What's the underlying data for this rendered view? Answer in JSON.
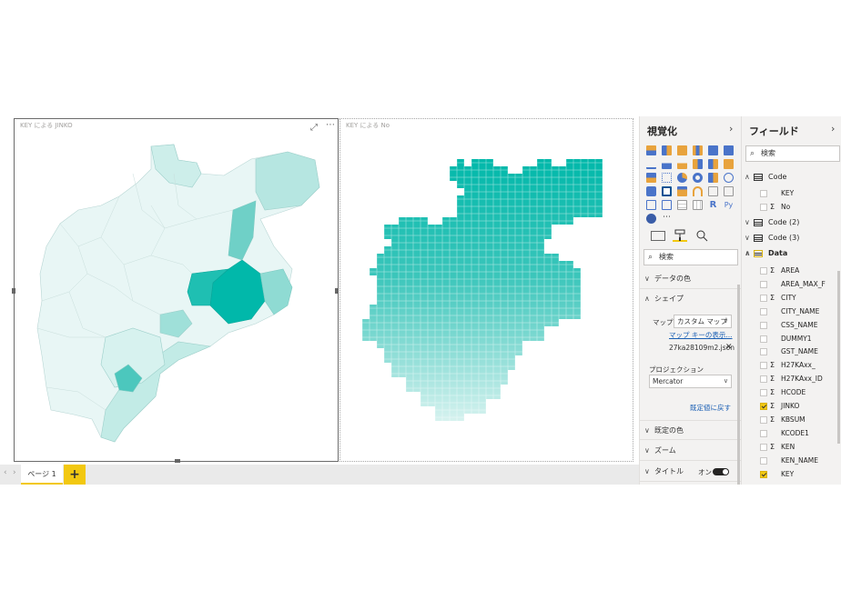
{
  "report": {
    "visuals": [
      {
        "title": "KEY による JINKO"
      },
      {
        "title": "KEY による No"
      }
    ],
    "more_icon": "⋯",
    "focus_icon": "⤢"
  },
  "page_tabs": {
    "prev": "‹",
    "next": "›",
    "page1_label": "ページ 1",
    "add_label": "+"
  },
  "viz_pane": {
    "title": "視覚化",
    "search_placeholder": "検索",
    "sections": {
      "data_colors": "データの色",
      "shape": "シェイプ",
      "default_color": "既定の色",
      "zoom": "ズーム",
      "title": "タイトル"
    },
    "shape": {
      "map_label": "マップ",
      "map_value": "カスタム マップ",
      "map_keys_link": "マップ キーの表示...",
      "file_name": "27ka28109m2.json",
      "projection_label": "プロジェクション",
      "projection_value": "Mercator",
      "reset_link": "既定値に戻す"
    },
    "title_toggle": "オン",
    "chevrons": {
      "collapse": "›",
      "right": "∨",
      "open": "∧"
    },
    "tab_icons": [
      "fields-icon",
      "format-roller-icon",
      "analytics-icon"
    ],
    "colors": {
      "accent": "#f2c811",
      "teal": "#01b8aa"
    }
  },
  "fields_pane": {
    "title": "フィールド",
    "search_placeholder": "検索",
    "tables": [
      {
        "name": "Code",
        "expanded": true
      },
      {
        "name": "Code (2)",
        "expanded": false
      },
      {
        "name": "Code (3)",
        "expanded": false
      },
      {
        "name": "Data",
        "expanded": true
      }
    ],
    "code_fields": [
      {
        "name": "KEY",
        "sigma": "",
        "checked": false
      },
      {
        "name": "No",
        "sigma": "Σ",
        "checked": false
      }
    ],
    "data_fields": [
      {
        "name": "AREA",
        "sigma": "Σ",
        "checked": false
      },
      {
        "name": "AREA_MAX_F",
        "sigma": "",
        "checked": false
      },
      {
        "name": "CITY",
        "sigma": "Σ",
        "checked": false
      },
      {
        "name": "CITY_NAME",
        "sigma": "",
        "checked": false
      },
      {
        "name": "CSS_NAME",
        "sigma": "",
        "checked": false
      },
      {
        "name": "DUMMY1",
        "sigma": "",
        "checked": false
      },
      {
        "name": "GST_NAME",
        "sigma": "",
        "checked": false
      },
      {
        "name": "H27KAxx_",
        "sigma": "Σ",
        "checked": false
      },
      {
        "name": "H27KAxx_ID",
        "sigma": "Σ",
        "checked": false
      },
      {
        "name": "HCODE",
        "sigma": "Σ",
        "checked": false
      },
      {
        "name": "JINKO",
        "sigma": "Σ",
        "checked": true
      },
      {
        "name": "KBSUM",
        "sigma": "Σ",
        "checked": false
      },
      {
        "name": "KCODE1",
        "sigma": "",
        "checked": false
      },
      {
        "name": "KEN",
        "sigma": "Σ",
        "checked": false
      },
      {
        "name": "KEN_NAME",
        "sigma": "",
        "checked": false
      },
      {
        "name": "KEY",
        "sigma": "",
        "checked": true
      }
    ],
    "chevron_expanded": "∧",
    "chevron_collapsed": "∨"
  }
}
